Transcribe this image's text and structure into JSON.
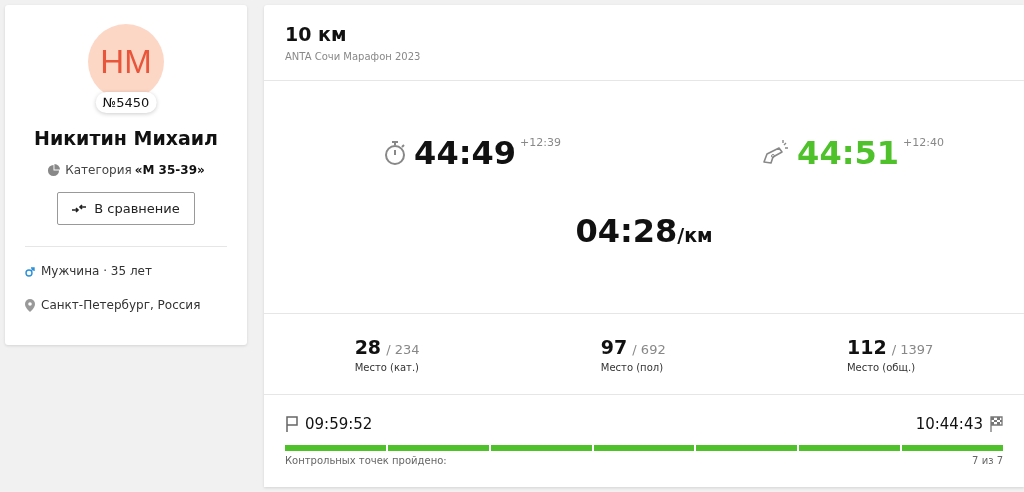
{
  "profile": {
    "initials": "НМ",
    "bib": "№5450",
    "name": "Никитин Михаил",
    "category_label": "Категория",
    "category": "«М 35-39»",
    "compare_button": "В сравнение",
    "gender_age": "Мужчина · 35 лет",
    "city": "Санкт-Петербург, Россия"
  },
  "race": {
    "distance": "10 км",
    "event": "ANTA Сочи Марафон 2023"
  },
  "times": [
    {
      "kind": "net",
      "value": "44:49",
      "gap": "+12:39"
    },
    {
      "kind": "gun",
      "value": "44:51",
      "gap": "+12:40"
    }
  ],
  "pace": {
    "value": "04:28",
    "unit": "/км"
  },
  "places": [
    {
      "place": "28",
      "total": "/ 234",
      "label": "Место (кат.)"
    },
    {
      "place": "97",
      "total": "/ 692",
      "label": "Место (пол)"
    },
    {
      "place": "112",
      "total": "/ 1397",
      "label": "Место (общ.)"
    }
  ],
  "checkpoints": {
    "start": "09:59:52",
    "finish": "10:44:43",
    "label": "Контрольных точек пройдено:",
    "count": "7 из 7",
    "segments": [
      {
        "passed": true
      },
      {
        "passed": true
      },
      {
        "passed": true
      },
      {
        "passed": true
      },
      {
        "passed": true
      },
      {
        "passed": true
      },
      {
        "passed": true
      }
    ]
  }
}
